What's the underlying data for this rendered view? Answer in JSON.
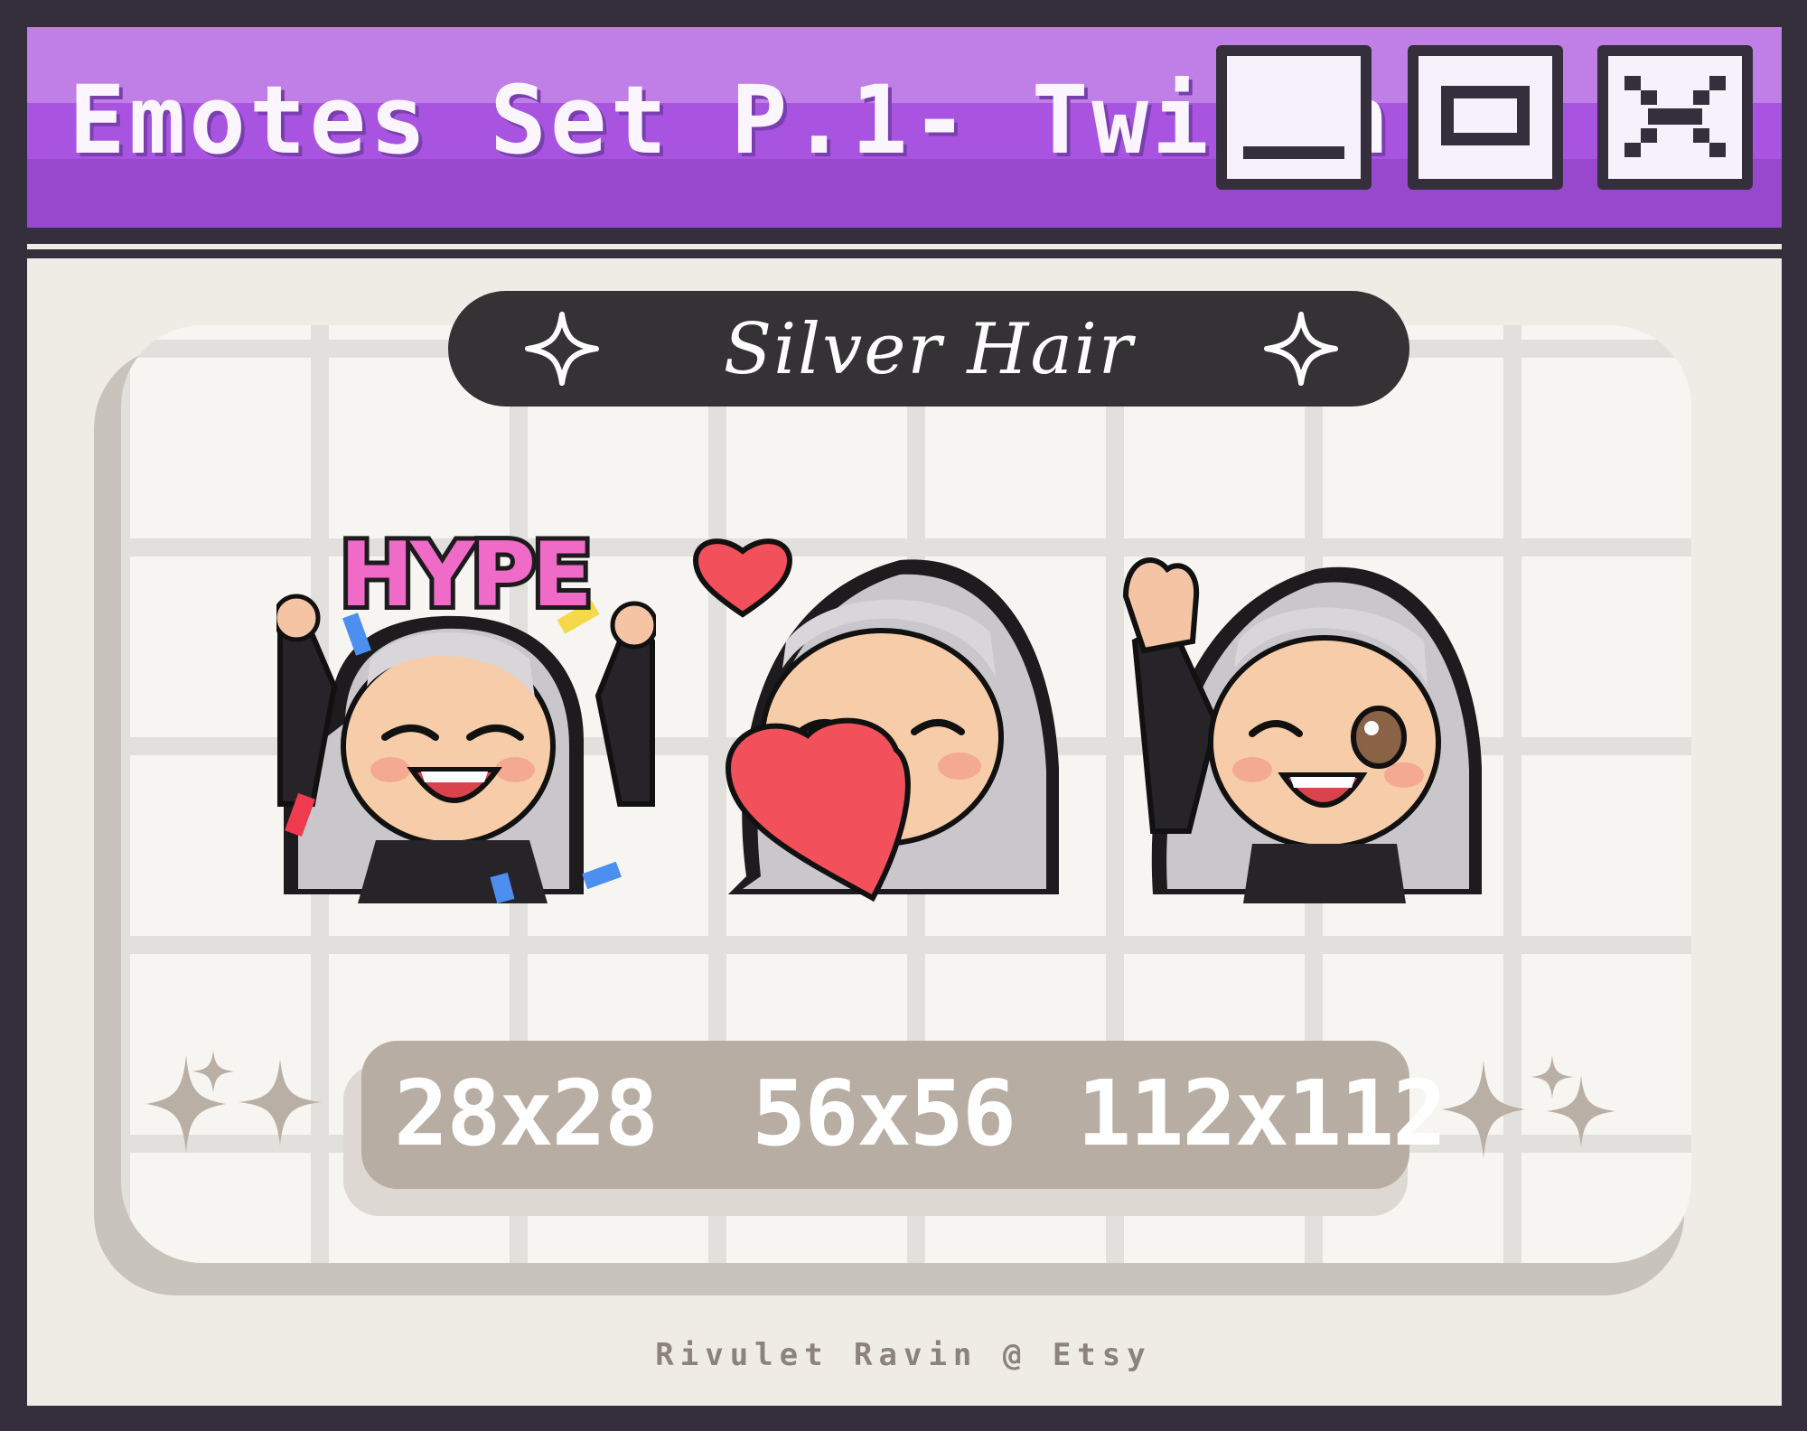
{
  "window": {
    "title": "Emotes Set P.1- Twitch",
    "title_color": "#faf5ff",
    "titlebar_colors": [
      "#c07fe6",
      "#a854e0",
      "#9748cc"
    ],
    "controls": [
      {
        "name": "minimize",
        "icon": "minimize-icon"
      },
      {
        "name": "maximize",
        "icon": "maximize-icon"
      },
      {
        "name": "close",
        "icon": "close-icon"
      }
    ]
  },
  "header": {
    "label": "Silver Hair",
    "star_icon": "four-point-star-icon"
  },
  "emotes": [
    {
      "name": "hype",
      "caption": "HYPE"
    },
    {
      "name": "heart",
      "icon": "heart-icon"
    },
    {
      "name": "wave"
    }
  ],
  "sizes": [
    "28x28",
    "56x56",
    "112x112"
  ],
  "footer": "Rivulet Ravin @ Etsy",
  "colors": {
    "frame": "#352e3c",
    "panel": "#f6f5f2",
    "grid": "#e2e0dc",
    "sizes_pill": "#b7ada3",
    "sparkle": "#b9afa5"
  }
}
